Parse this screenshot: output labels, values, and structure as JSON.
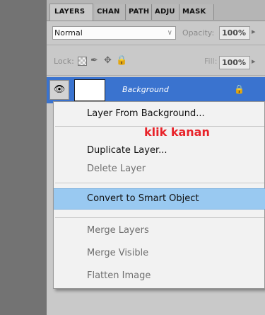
{
  "tabs": [
    "LAYERS",
    "CHAN",
    "PATH",
    "ADJU",
    "MASK"
  ],
  "blend_mode": {
    "value": "Normal"
  },
  "opacity": {
    "label": "Opacity:",
    "value": "100%"
  },
  "lock": {
    "label": "Lock:"
  },
  "fill": {
    "label": "Fill:",
    "value": "100%"
  },
  "layer": {
    "name": "Background"
  },
  "context_menu": {
    "items": [
      {
        "label": "Layer From Background...",
        "enabled": true
      },
      {
        "label": "Duplicate Layer...",
        "enabled": true
      },
      {
        "label": "Delete Layer",
        "enabled": false
      },
      {
        "label": "Convert to Smart Object",
        "enabled": true,
        "highlighted": true
      },
      {
        "label": "Merge Layers",
        "enabled": false
      },
      {
        "label": "Merge Visible",
        "enabled": false
      },
      {
        "label": "Flatten Image",
        "enabled": false
      }
    ],
    "highlight_color": "#99c9f1"
  },
  "annotation": {
    "text": "klik kanan",
    "color": "#e8232a"
  },
  "colors": {
    "selected_layer": "#3a73cf",
    "panel": "#c9c9c9"
  },
  "icons": [
    "eye-icon",
    "lock-transparent-icon",
    "lock-brush-icon",
    "lock-move-icon",
    "lock-all-icon",
    "layer-lock-icon",
    "dropdown-arrow-icon"
  ]
}
